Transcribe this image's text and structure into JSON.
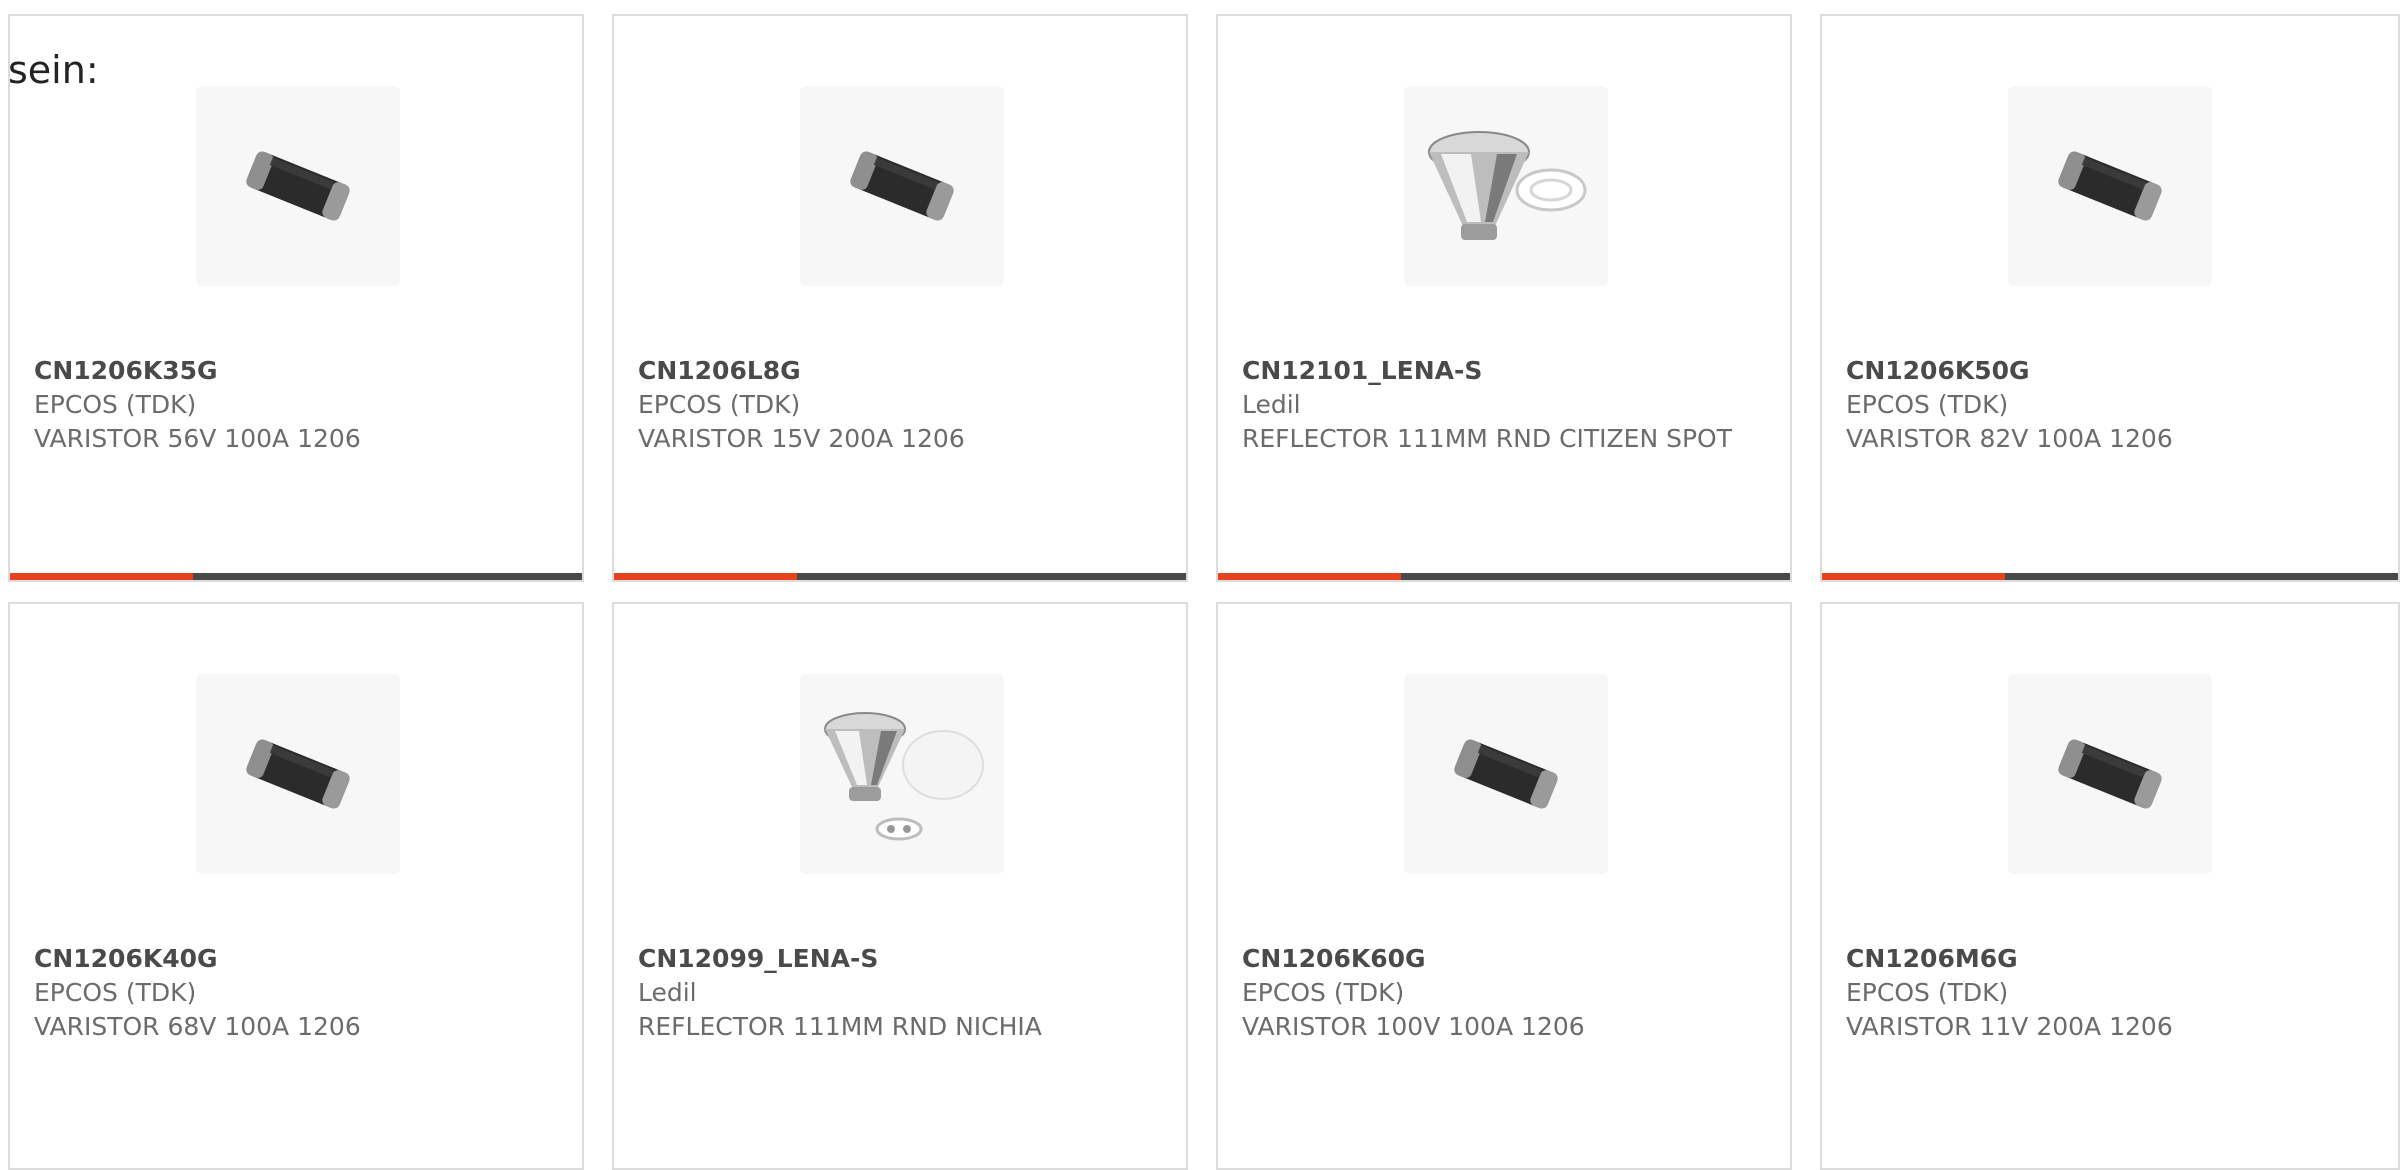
{
  "intro_text": "sein:",
  "accent_color": "#e8411e",
  "bar_color": "#4a4a4a",
  "products": [
    {
      "part_number": "CN1206K35G",
      "manufacturer": "EPCOS (TDK)",
      "description": "VARISTOR 56V 100A 1206",
      "image": "chip-varistor-image"
    },
    {
      "part_number": "CN1206L8G",
      "manufacturer": "EPCOS (TDK)",
      "description": "VARISTOR 15V 200A 1206",
      "image": "chip-varistor-image"
    },
    {
      "part_number": "CN12101_LENA-S",
      "manufacturer": "Ledil",
      "description": "REFLECTOR 111MM RND CITIZEN SPOT",
      "image": "reflector-image"
    },
    {
      "part_number": "CN1206K50G",
      "manufacturer": "EPCOS (TDK)",
      "description": "VARISTOR 82V 100A 1206",
      "image": "chip-varistor-image"
    },
    {
      "part_number": "CN1206K40G",
      "manufacturer": "EPCOS (TDK)",
      "description": "VARISTOR 68V 100A 1206",
      "image": "chip-varistor-image"
    },
    {
      "part_number": "CN12099_LENA-S",
      "manufacturer": "Ledil",
      "description": "REFLECTOR 111MM RND NICHIA",
      "image": "reflector-lens-image"
    },
    {
      "part_number": "CN1206K60G",
      "manufacturer": "EPCOS (TDK)",
      "description": "VARISTOR 100V 100A 1206",
      "image": "chip-varistor-image"
    },
    {
      "part_number": "CN1206M6G",
      "manufacturer": "EPCOS (TDK)",
      "description": "VARISTOR 11V 200A 1206",
      "image": "chip-varistor-image"
    }
  ]
}
